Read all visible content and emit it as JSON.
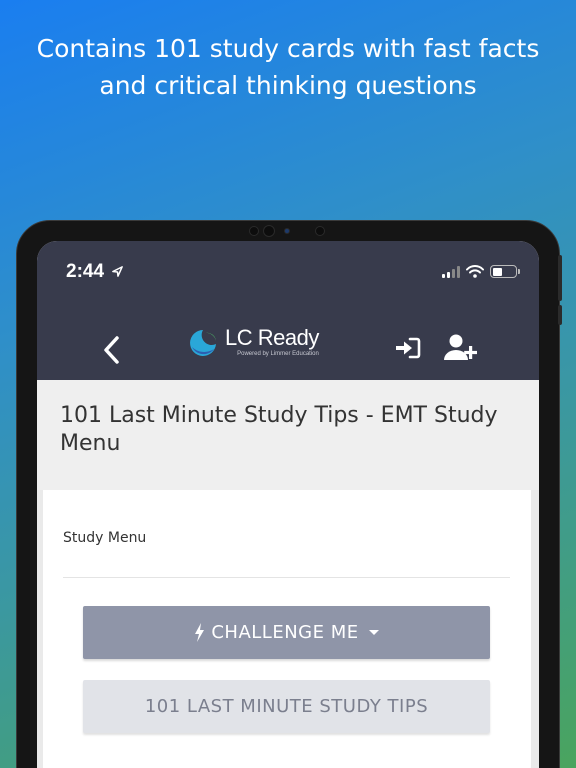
{
  "promo": {
    "line1": "Contains 101 study cards with fast facts",
    "line2": "and critical thinking questions"
  },
  "status_bar": {
    "time": "2:44",
    "icons": [
      "location-arrow-icon",
      "cellular-signal-icon",
      "wifi-icon",
      "battery-icon"
    ]
  },
  "header": {
    "back_icon": "chevron-left-icon",
    "logo_text": "LC Ready",
    "logo_tagline": "Powered by Limmer Education",
    "login_icon": "sign-in-icon",
    "signup_icon": "user-plus-icon",
    "background_color": "#383b4c"
  },
  "page": {
    "title": "101 Last Minute Study Tips - EMT Study Menu"
  },
  "card": {
    "heading": "Study Menu",
    "challenge_button": {
      "icon": "lightning-bolt-icon",
      "label": "CHALLENGE ME",
      "dropdown_icon": "caret-down-icon"
    },
    "tips_button": {
      "label": "101 LAST MINUTE STUDY TIPS"
    }
  },
  "colors": {
    "challenge_button": "#8f95a8",
    "tips_button": "#e1e3e8",
    "gradient_top": "#1a7ef0",
    "gradient_bottom": "#4aa45e"
  }
}
